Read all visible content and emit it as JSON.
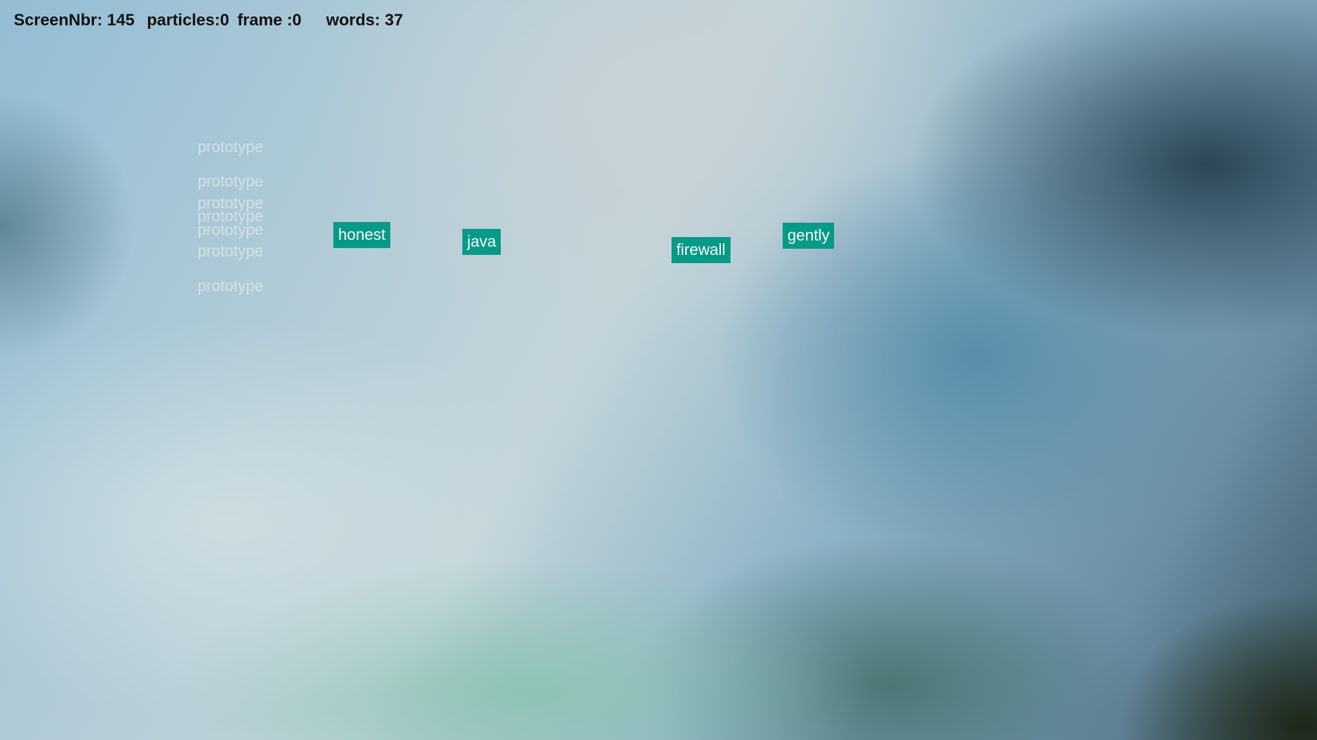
{
  "hud": {
    "screen_nbr": "ScreenNbr: 145",
    "particles": "particles:0",
    "frame": "frame :0",
    "words": "words: 37"
  },
  "ghost_words": [
    "prototype",
    "prototype",
    "prototype",
    "prototype",
    "prototype",
    "prototype",
    "prototype"
  ],
  "word_tiles": [
    "honest",
    "java",
    "firewall",
    "gently"
  ],
  "colors": {
    "tile_background": "#079a86",
    "tile_text": "#f4fbfa",
    "ghost_text": "#e1e8eb",
    "hud_text": "#111111"
  }
}
